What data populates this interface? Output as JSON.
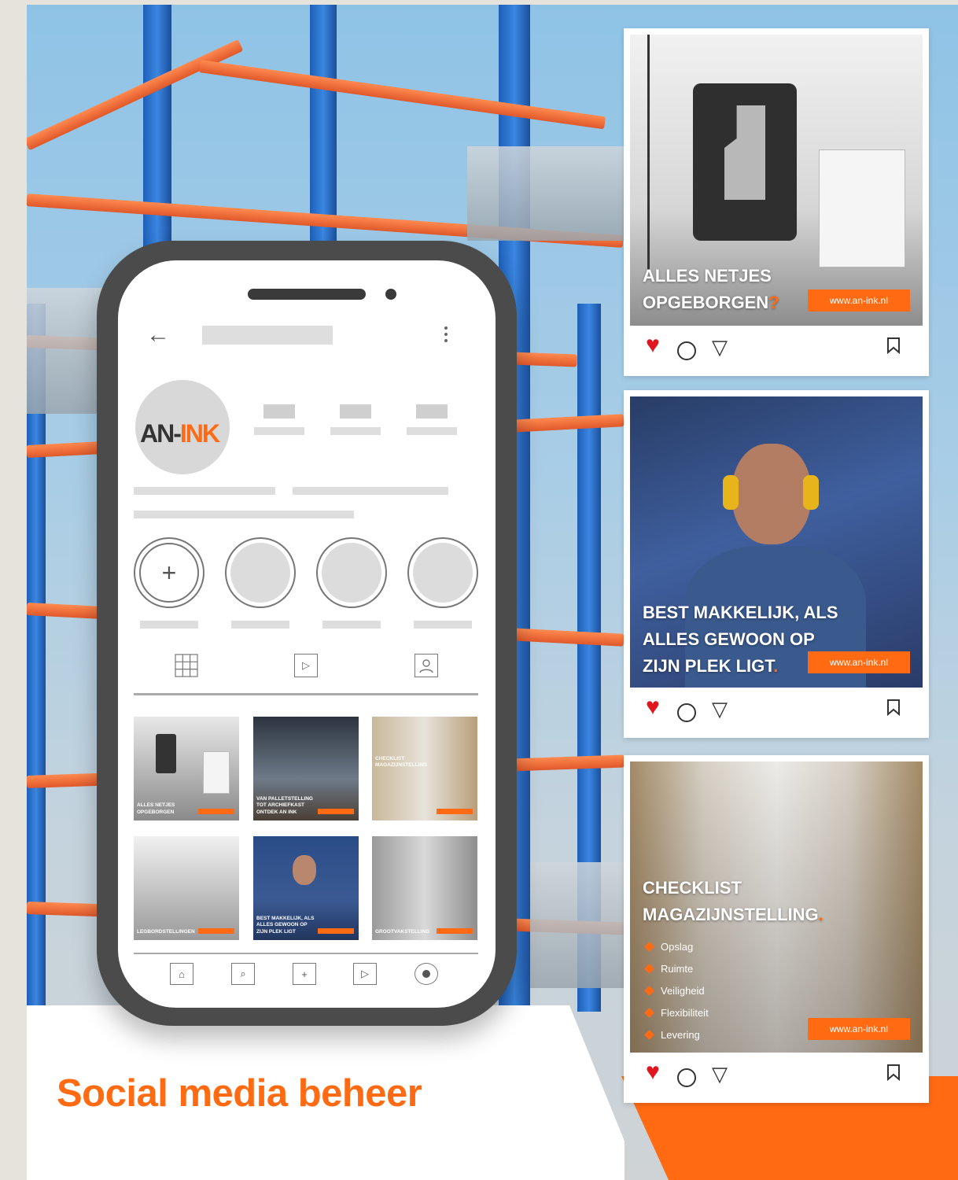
{
  "brand": {
    "logo_part1": "AN-",
    "logo_part2": "INK",
    "accent": "#ff6a13"
  },
  "headline": "Social media beheer",
  "profile_grid": [
    {
      "caption": "ALLES NETJES OPGEBORGEN"
    },
    {
      "caption": "VAN PALLETSTELLING TOT ARCHIEFKAST ONTDEK AN INK"
    },
    {
      "caption": "CHECKLIST MAGAZIJNSTELLING"
    },
    {
      "caption": "LEGBORDSTELLINGEN"
    },
    {
      "caption": "BEST MAKKELIJK, ALS ALLES GEWOON OP ZIJN PLEK LIGT"
    },
    {
      "caption": "GROOTVAKSTELLING"
    }
  ],
  "posts": [
    {
      "line1": "ALLES NETJES",
      "line2": "OPGEBORGEN",
      "mark": "?",
      "url": "www.an-ink.nl"
    },
    {
      "line1": "BEST MAKKELIJK, ALS",
      "line2": "ALLES GEWOON OP",
      "line3": "ZIJN PLEK LIGT",
      "mark": ".",
      "url": "www.an-ink.nl"
    },
    {
      "line1": "CHECKLIST",
      "line2": "MAGAZIJNSTELLING",
      "mark": ".",
      "url": "www.an-ink.nl",
      "items": [
        "Opslag",
        "Ruimte",
        "Veiligheid",
        "Flexibiliteit",
        "Levering"
      ]
    }
  ],
  "icons": {
    "back": "←",
    "add": "+",
    "like": "♥",
    "send": "▽",
    "bookmark": "⊓"
  }
}
